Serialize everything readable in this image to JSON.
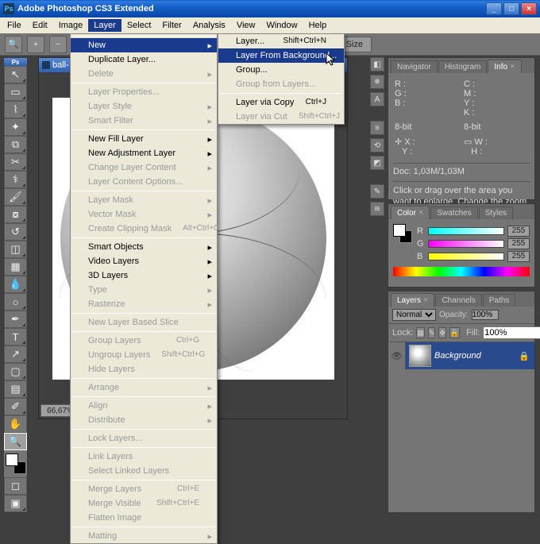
{
  "title": "Adobe Photoshop CS3 Extended",
  "menubar": [
    "File",
    "Edit",
    "Image",
    "Layer",
    "Select",
    "Filter",
    "Analysis",
    "View",
    "Window",
    "Help"
  ],
  "open_menu_index": 3,
  "optionsbar": {
    "print_size": "Print Size"
  },
  "layer_menu": [
    {
      "t": "sep"
    },
    {
      "label": "New",
      "arrow": true,
      "hl": true
    },
    {
      "label": "Duplicate Layer..."
    },
    {
      "label": "Delete",
      "arrow": true,
      "dis": true
    },
    {
      "t": "sep"
    },
    {
      "label": "Layer Properties...",
      "dis": true
    },
    {
      "label": "Layer Style",
      "arrow": true,
      "dis": true
    },
    {
      "label": "Smart Filter",
      "arrow": true,
      "dis": true
    },
    {
      "t": "sep"
    },
    {
      "label": "New Fill Layer",
      "arrow": true
    },
    {
      "label": "New Adjustment Layer",
      "arrow": true
    },
    {
      "label": "Change Layer Content",
      "arrow": true,
      "dis": true
    },
    {
      "label": "Layer Content Options...",
      "dis": true
    },
    {
      "t": "sep"
    },
    {
      "label": "Layer Mask",
      "arrow": true,
      "dis": true
    },
    {
      "label": "Vector Mask",
      "arrow": true,
      "dis": true
    },
    {
      "label": "Create Clipping Mask",
      "sc": "Alt+Ctrl+G",
      "dis": true
    },
    {
      "t": "sep"
    },
    {
      "label": "Smart Objects",
      "arrow": true
    },
    {
      "label": "Video Layers",
      "arrow": true
    },
    {
      "label": "3D Layers",
      "arrow": true
    },
    {
      "label": "Type",
      "arrow": true,
      "dis": true
    },
    {
      "label": "Rasterize",
      "arrow": true,
      "dis": true
    },
    {
      "t": "sep"
    },
    {
      "label": "New Layer Based Slice",
      "dis": true
    },
    {
      "t": "sep"
    },
    {
      "label": "Group Layers",
      "sc": "Ctrl+G",
      "dis": true
    },
    {
      "label": "Ungroup Layers",
      "sc": "Shift+Ctrl+G",
      "dis": true
    },
    {
      "label": "Hide Layers",
      "dis": true
    },
    {
      "t": "sep"
    },
    {
      "label": "Arrange",
      "arrow": true,
      "dis": true
    },
    {
      "t": "sep"
    },
    {
      "label": "Align",
      "arrow": true,
      "dis": true
    },
    {
      "label": "Distribute",
      "arrow": true,
      "dis": true
    },
    {
      "t": "sep"
    },
    {
      "label": "Lock Layers...",
      "dis": true
    },
    {
      "t": "sep"
    },
    {
      "label": "Link Layers",
      "dis": true
    },
    {
      "label": "Select Linked Layers",
      "dis": true
    },
    {
      "t": "sep"
    },
    {
      "label": "Merge Layers",
      "sc": "Ctrl+E",
      "dis": true
    },
    {
      "label": "Merge Visible",
      "sc": "Shift+Ctrl+E",
      "dis": true
    },
    {
      "label": "Flatten Image",
      "dis": true
    },
    {
      "t": "sep"
    },
    {
      "label": "Matting",
      "arrow": true,
      "dis": true
    }
  ],
  "new_submenu": [
    {
      "label": "Layer...",
      "sc": "Shift+Ctrl+N"
    },
    {
      "label": "Layer From Background...",
      "hl": true
    },
    {
      "label": "Group..."
    },
    {
      "label": "Group from Layers...",
      "dis": true
    },
    {
      "t": "sep"
    },
    {
      "label": "Layer via Copy",
      "sc": "Ctrl+J"
    },
    {
      "label": "Layer via Cut",
      "sc": "Shift+Ctrl+J",
      "dis": true
    }
  ],
  "doc": {
    "title": "ball-",
    "zoom": "66,67%"
  },
  "info": {
    "r": "R :",
    "g": "G :",
    "b": "B :",
    "x": "X :",
    "y": "Y :",
    "w": "W :",
    "h": "H :",
    "k": "K :",
    "bits": "8-bit",
    "doc": "Doc: 1,03M/1,03M",
    "hint": "Click or drag over the area you want to enlarge. Change the zoom state on the Options bar."
  },
  "panels": {
    "info_tabs": [
      "Navigator",
      "Histogram",
      "Info"
    ],
    "color_tabs": [
      "Color",
      "Swatches",
      "Styles"
    ],
    "layers_tabs": [
      "Layers",
      "Channels",
      "Paths"
    ]
  },
  "color": {
    "r": "R",
    "g": "G",
    "b": "B",
    "val": "255"
  },
  "layers": {
    "blend": "Normal",
    "opacity_lbl": "Opacity:",
    "opacity": "100%",
    "lock_lbl": "Lock:",
    "fill_lbl": "Fill:",
    "fill": "100%",
    "layer_name": "Background"
  }
}
